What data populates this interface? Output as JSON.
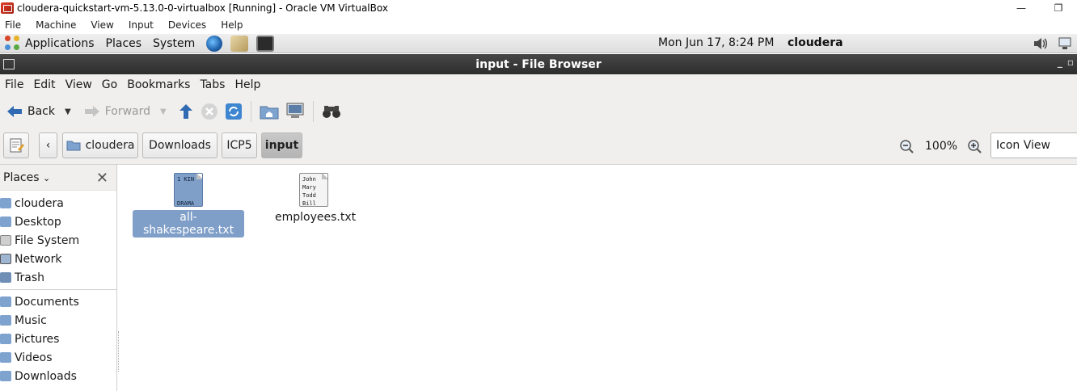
{
  "host": {
    "title": "cloudera-quickstart-vm-5.13.0-0-virtualbox [Running] - Oracle VM VirtualBox",
    "menu": [
      "File",
      "Machine",
      "View",
      "Input",
      "Devices",
      "Help"
    ],
    "minimize_glyph": "—",
    "restore_glyph": "❐"
  },
  "panel": {
    "applications": "Applications",
    "places": "Places",
    "system": "System",
    "clock": "Mon Jun 17,  8:24 PM",
    "user": "cloudera"
  },
  "window": {
    "title": "input - File Browser",
    "menu": [
      "File",
      "Edit",
      "View",
      "Go",
      "Bookmarks",
      "Tabs",
      "Help"
    ]
  },
  "toolbar": {
    "back": "Back",
    "forward": "Forward"
  },
  "pathbar": {
    "crumbs": [
      "cloudera",
      "Downloads",
      "ICP5",
      "input"
    ],
    "zoom": "100%",
    "view_mode": "Icon View"
  },
  "sidebar": {
    "header": "Places",
    "places": [
      "cloudera",
      "Desktop",
      "File System",
      "Network",
      "Trash"
    ],
    "bookmarks": [
      "Documents",
      "Music",
      "Pictures",
      "Videos",
      "Downloads"
    ]
  },
  "files": [
    {
      "name": "all-shakespeare.txt",
      "preview": [
        "1 KIN",
        "",
        "",
        "DRAMA"
      ],
      "selected": true
    },
    {
      "name": "employees.txt",
      "preview": [
        "John",
        "Mary",
        "Todd",
        "Bill"
      ],
      "selected": false
    }
  ],
  "colors": {
    "selection": "#7f9fc8",
    "titlebar": "#3a3a3a",
    "folder_icon": "#6d8fb8"
  }
}
